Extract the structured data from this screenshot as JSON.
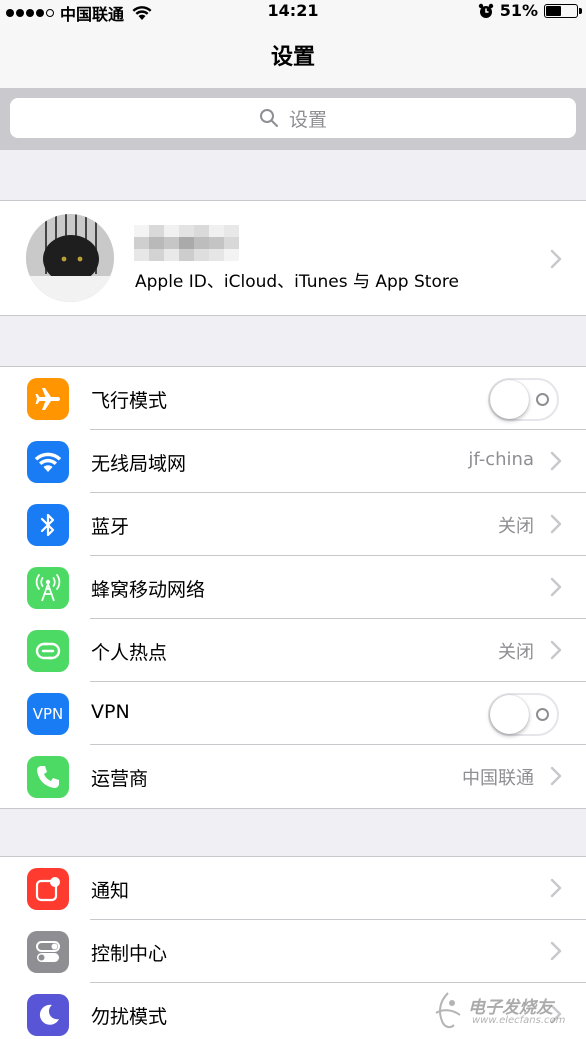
{
  "status_bar": {
    "carrier": "中国联通",
    "time": "14:21",
    "battery": "51%",
    "battery_level": 0.51,
    "signal_bars": 4,
    "icons": [
      "wifi-icon",
      "alarm-icon",
      "battery-icon"
    ]
  },
  "nav": {
    "title": "设置"
  },
  "search": {
    "placeholder": "设置"
  },
  "profile": {
    "subtitle": "Apple ID、iCloud、iTunes 与 App Store"
  },
  "group1": [
    {
      "id": "airplane",
      "label": "飞行模式",
      "icon": "airplane-icon",
      "color": "#ff9500",
      "control": "toggle",
      "on": false
    },
    {
      "id": "wifi",
      "label": "无线局域网",
      "icon": "wifi-icon",
      "color": "#1a7cf5",
      "detail": "jf-china",
      "control": "chevron"
    },
    {
      "id": "bluetooth",
      "label": "蓝牙",
      "icon": "bluetooth-icon",
      "color": "#1a7cf5",
      "detail": "关闭",
      "control": "chevron"
    },
    {
      "id": "cellular",
      "label": "蜂窝移动网络",
      "icon": "cellular-icon",
      "color": "#4cd964",
      "detail": "",
      "control": "chevron"
    },
    {
      "id": "hotspot",
      "label": "个人热点",
      "icon": "hotspot-icon",
      "color": "#4cd964",
      "detail": "关闭",
      "control": "chevron"
    },
    {
      "id": "vpn",
      "label": "VPN",
      "icon": "vpn-icon",
      "icon_text": "VPN",
      "color": "#1a7cf5",
      "control": "toggle",
      "on": false
    },
    {
      "id": "carrier",
      "label": "运营商",
      "icon": "phone-icon",
      "color": "#4cd964",
      "detail": "中国联通",
      "control": "chevron"
    }
  ],
  "group2": [
    {
      "id": "notifications",
      "label": "通知",
      "icon": "notifications-icon",
      "color": "#ff3b30",
      "control": "chevron"
    },
    {
      "id": "control-center",
      "label": "控制中心",
      "icon": "control-center-icon",
      "color": "#8e8e93",
      "control": "chevron"
    },
    {
      "id": "dnd",
      "label": "勿扰模式",
      "icon": "moon-icon",
      "color": "#5856d6",
      "control": "chevron"
    }
  ],
  "watermark": {
    "text": "电子发烧友",
    "url": "www.elecfans.com"
  }
}
